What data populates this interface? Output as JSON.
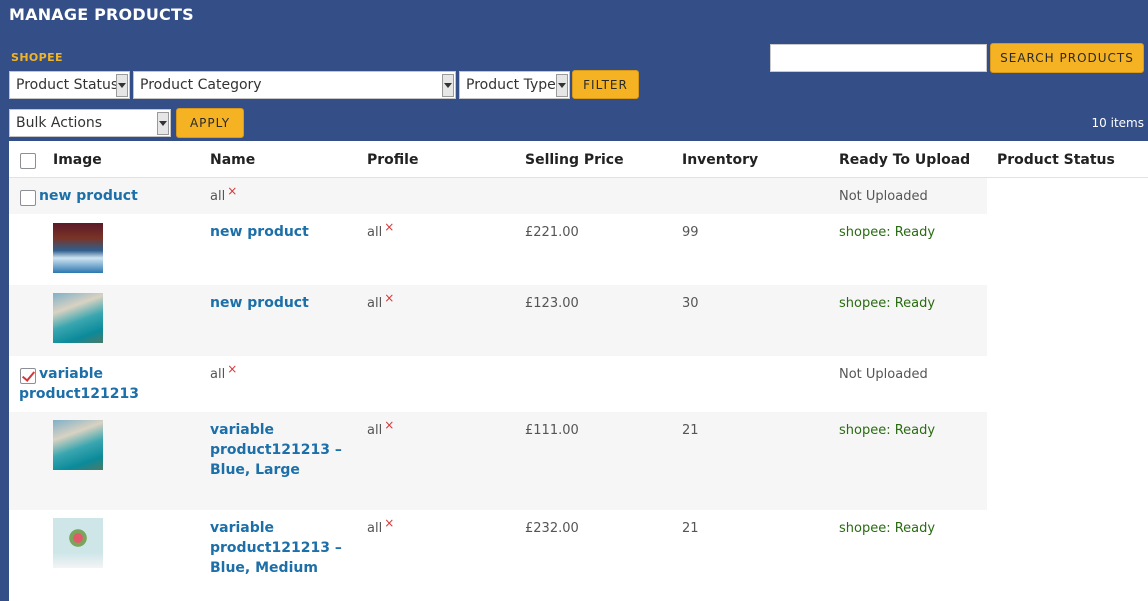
{
  "page": {
    "title": "MANAGE PRODUCTS",
    "section_label": "SHOPEE"
  },
  "search": {
    "value": "",
    "placeholder": "",
    "button_label": "SEARCH PRODUCTS"
  },
  "filters": {
    "status_label": "Product Status",
    "category_label": "Product Category",
    "type_label": "Product Type",
    "filter_button": "FILTER"
  },
  "bulk": {
    "label": "Bulk Actions",
    "apply_button": "APPLY"
  },
  "items_count": "10 items",
  "table": {
    "headers": {
      "image": "Image",
      "name": "Name",
      "profile": "Profile",
      "price": "Selling Price",
      "inventory": "Inventory",
      "ready": "Ready To Upload",
      "status": "Product Status"
    },
    "rows": [
      {
        "type": "parent",
        "name": "new product",
        "profile": "all",
        "ready": "Not Uploaded",
        "checked": false
      },
      {
        "type": "child",
        "image": "wave",
        "name": "new product",
        "profile": "all",
        "price": "£221.00",
        "inventory": "99",
        "ready": "shopee: Ready"
      },
      {
        "type": "child",
        "image": "coast",
        "name": "new product",
        "profile": "all",
        "price": "£123.00",
        "inventory": "30",
        "ready": "shopee: Ready"
      },
      {
        "type": "parent",
        "name_line1": "variable",
        "name_line2": "product121213",
        "profile": "all",
        "ready": "Not Uploaded",
        "checked": true
      },
      {
        "type": "child",
        "image": "coast",
        "name_line1": "variable",
        "name_line2": "product121213 –",
        "name_line3": "Blue, Large",
        "profile": "all",
        "price": "£111.00",
        "inventory": "21",
        "ready": "shopee: Ready"
      },
      {
        "type": "child",
        "image": "flower",
        "name_line1": "variable",
        "name_line2": "product121213 –",
        "name_line3": "Blue, Medium",
        "profile": "all",
        "price": "£232.00",
        "inventory": "21",
        "ready": "shopee: Ready"
      }
    ],
    "remove_icon": "×"
  },
  "colors": {
    "background": "#344e87",
    "accent": "#f5b222",
    "link": "#1c6fa8",
    "ready": "#2a6b12",
    "remove": "#d63638"
  }
}
